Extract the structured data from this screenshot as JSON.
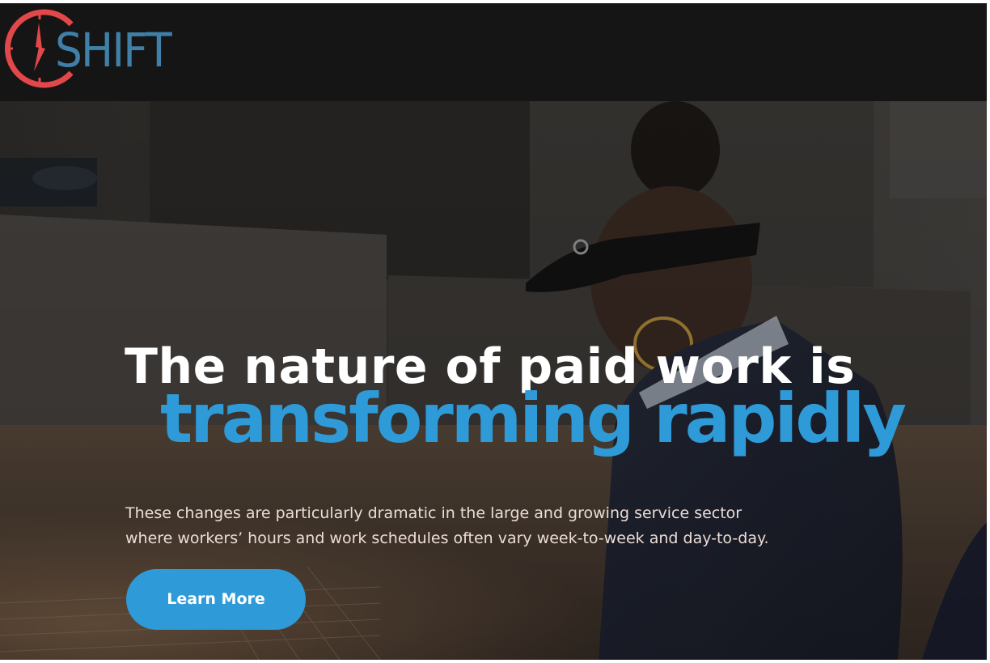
{
  "brand": {
    "logo_text": "SHIFT",
    "colors": {
      "header_bg": "#151515",
      "logo_blue": "#3f7fa8",
      "clock_red": "#e2474a",
      "accent_blue": "#2e9ad8"
    },
    "logo_icon": "clock-icon"
  },
  "hero": {
    "headline_line1": "The nature of paid work is",
    "headline_line2": "transforming rapidly",
    "subtext_line1": "These changes are particularly dramatic in the large and growing service sector",
    "subtext_line2": "where workers’ hours and work schedules often vary week-to-week and day-to-day.",
    "cta_label": "Learn More"
  }
}
